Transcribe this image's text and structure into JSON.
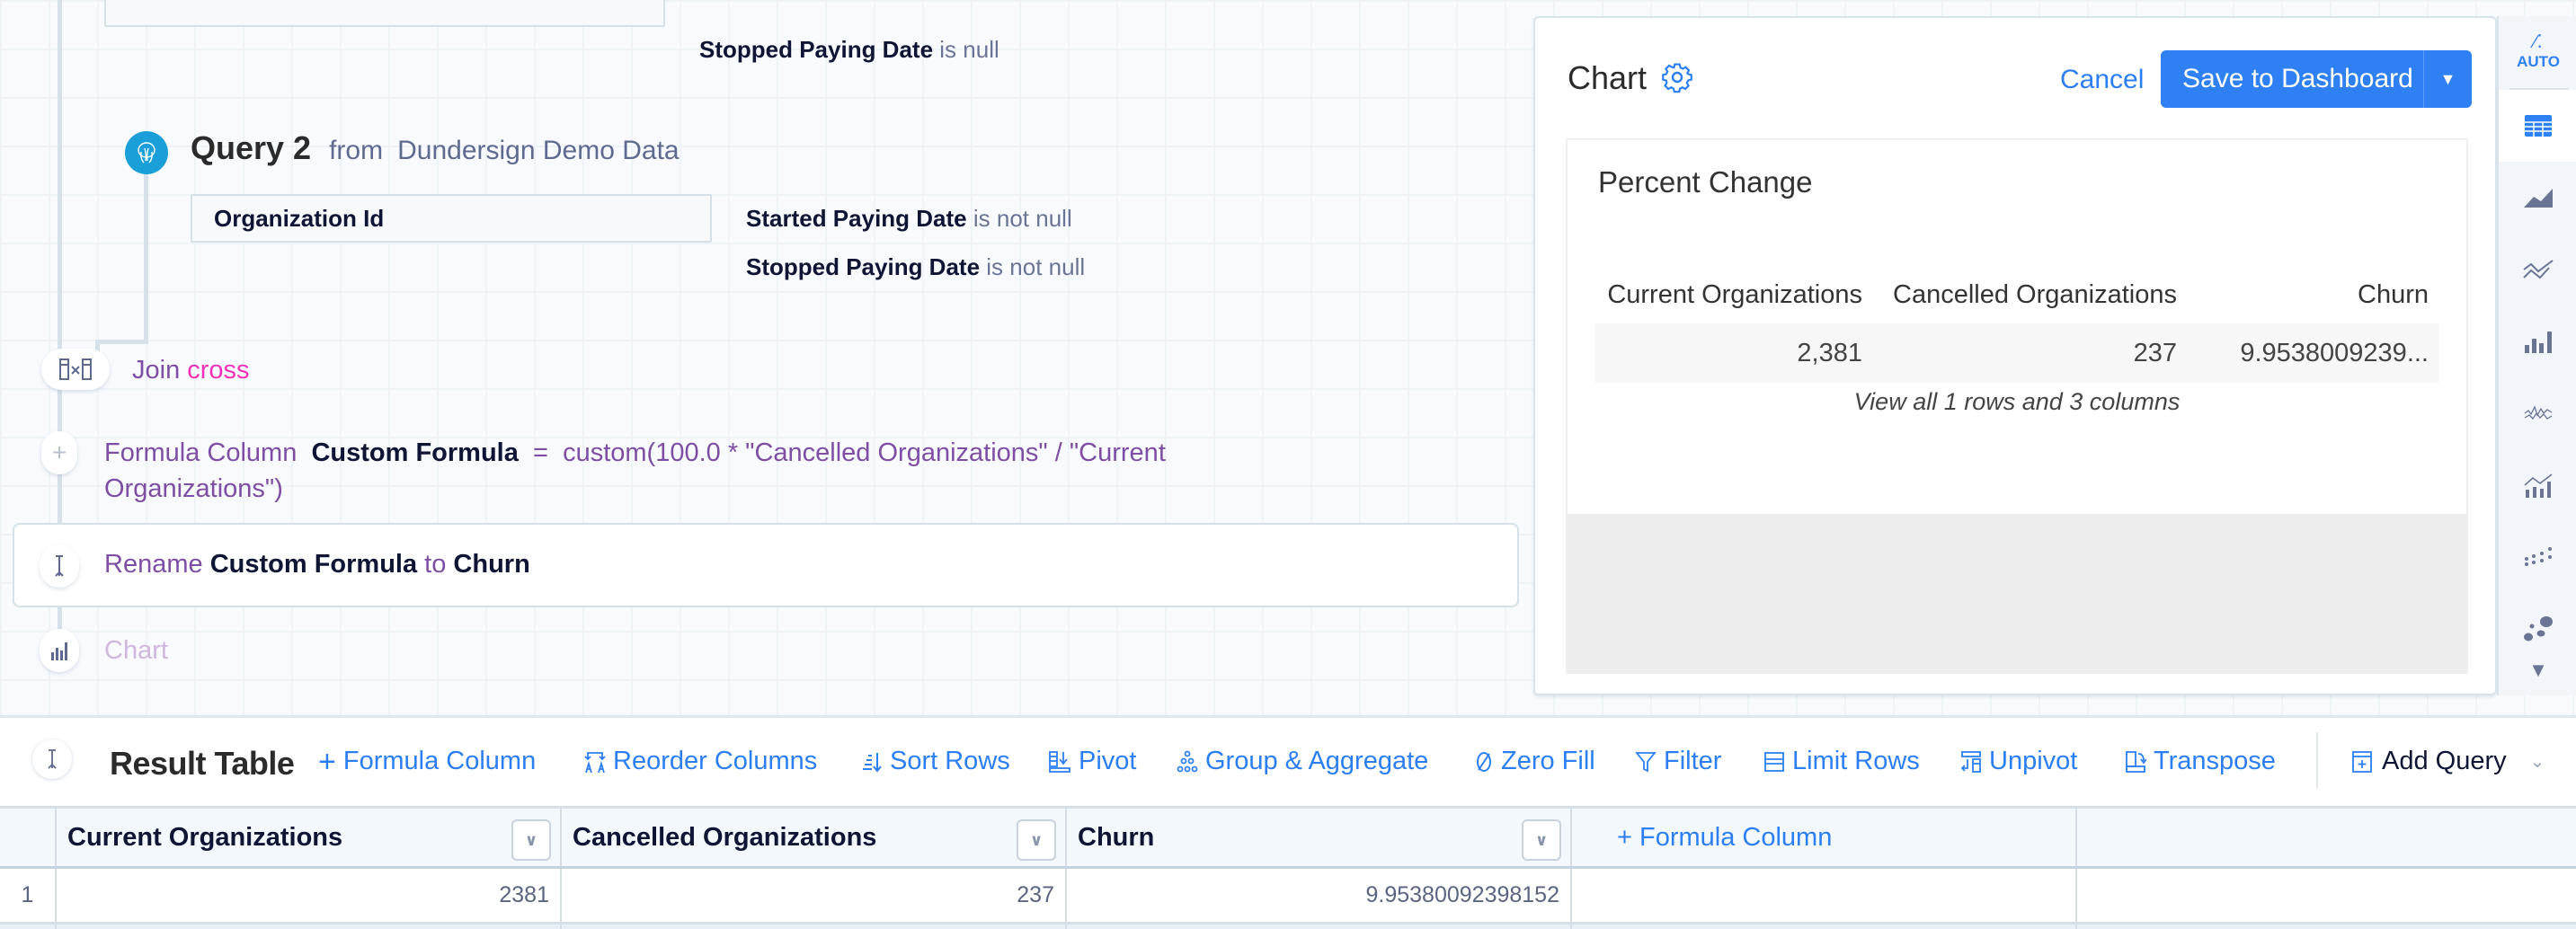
{
  "query1": {
    "partial_conditions": [
      {
        "field": "Stopped Paying Date",
        "op": "is null"
      }
    ]
  },
  "query2": {
    "title": "Query 2",
    "from_label": "from",
    "source": "Dundersign Demo Data",
    "columns": [
      "Organization Id"
    ],
    "conditions": [
      {
        "field": "Started Paying Date",
        "op": "is not null"
      },
      {
        "field": "Stopped Paying Date",
        "op": "is not null"
      }
    ],
    "icon": "postgres-elephant-icon"
  },
  "steps": {
    "join": {
      "label": "Join",
      "type": "cross",
      "icon": "cross-join-icon"
    },
    "formula": {
      "label": "Formula Column",
      "name": "Custom Formula",
      "equals": "=",
      "expr_line1": "custom(100.0 * \"Cancelled Organizations\" / \"Current",
      "expr_line2": "Organizations\")",
      "icon": "plus-icon"
    },
    "rename": {
      "label": "Rename",
      "from": "Custom Formula",
      "to_word": "to",
      "to": "Churn",
      "icon": "rename-cursor-icon"
    },
    "chart": {
      "label": "Chart",
      "icon": "bar-chart-icon"
    }
  },
  "chart_panel": {
    "title": "Chart",
    "settings_icon": "gear-icon",
    "cancel_label": "Cancel",
    "save_label": "Save to Dashboard",
    "preview": {
      "title": "Percent Change",
      "headers": [
        "Current Organizations",
        "Cancelled Organizations",
        "Churn"
      ],
      "row": [
        "2,381",
        "237",
        "9.9538009239..."
      ],
      "view_all": "View all 1 rows and 3 columns"
    },
    "types": [
      {
        "name": "auto",
        "label": "AUTO",
        "selected": false
      },
      {
        "name": "table",
        "selected": true
      },
      {
        "name": "area",
        "selected": false
      },
      {
        "name": "line",
        "selected": false
      },
      {
        "name": "bar",
        "selected": false
      },
      {
        "name": "sparkline",
        "selected": false
      },
      {
        "name": "bar-line",
        "selected": false
      },
      {
        "name": "scatter",
        "selected": false
      },
      {
        "name": "bubble",
        "selected": false
      },
      {
        "name": "more",
        "selected": false
      }
    ]
  },
  "result_table": {
    "title": "Result Table",
    "toolbar": [
      {
        "label": "Formula Column",
        "icon": "plus-icon"
      },
      {
        "label": "Reorder Columns",
        "icon": "reorder-columns-icon"
      },
      {
        "label": "Sort Rows",
        "icon": "sort-rows-icon"
      },
      {
        "label": "Pivot",
        "icon": "pivot-icon"
      },
      {
        "label": "Group & Aggregate",
        "icon": "group-aggregate-icon"
      },
      {
        "label": "Zero Fill",
        "icon": "zero-fill-icon"
      },
      {
        "label": "Filter",
        "icon": "filter-icon"
      },
      {
        "label": "Limit Rows",
        "icon": "limit-rows-icon"
      },
      {
        "label": "Unpivot",
        "icon": "unpivot-icon"
      },
      {
        "label": "Transpose",
        "icon": "transpose-icon"
      }
    ],
    "add_query_label": "Add Query",
    "columns": [
      "Current Organizations",
      "Cancelled Organizations",
      "Churn"
    ],
    "add_formula_label": "+ Formula Column",
    "rows": [
      {
        "num": "1",
        "values": [
          "2381",
          "237",
          "9.95380092398152"
        ]
      }
    ]
  },
  "colors": {
    "accent": "#2f80f2",
    "db_icon": "#1a9fd8",
    "step_purple": "#7d4ea3",
    "join_pink": "#ef32b8"
  }
}
